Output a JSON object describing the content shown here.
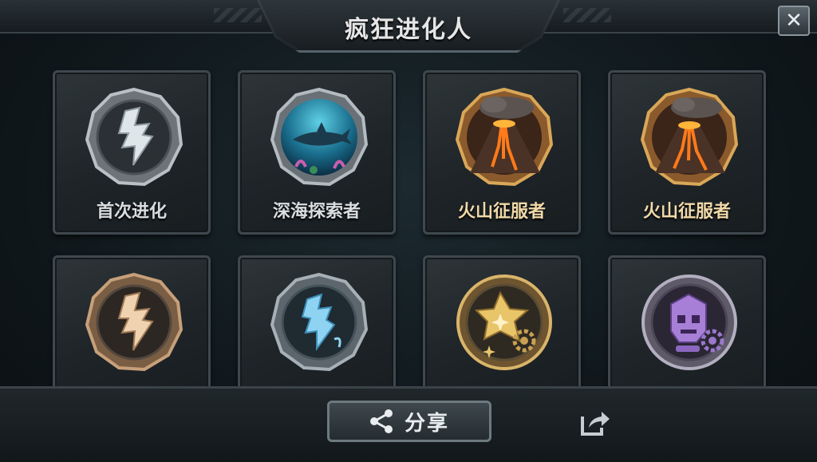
{
  "header": {
    "title": "疯狂进化人"
  },
  "close_label": "✕",
  "badges": [
    {
      "label": "首次进化",
      "icon": "silver-evolution-badge-icon"
    },
    {
      "label": "深海探索者",
      "icon": "deep-sea-shark-badge-icon"
    },
    {
      "label": "火山征服者",
      "icon": "volcano-badge-icon"
    },
    {
      "label": "火山征服者",
      "icon": "volcano-badge-icon"
    },
    {
      "label": "",
      "icon": "bronze-evolution-badge-icon"
    },
    {
      "label": "",
      "icon": "ice-evolution-badge-icon"
    },
    {
      "label": "",
      "icon": "gold-star-gear-badge-icon"
    },
    {
      "label": "",
      "icon": "purple-robot-gear-badge-icon"
    }
  ],
  "footer": {
    "share_label": "分享"
  },
  "colors": {
    "accent_gold": "#d9a758",
    "panel": "#1e2428",
    "text": "#e8e8e8"
  }
}
